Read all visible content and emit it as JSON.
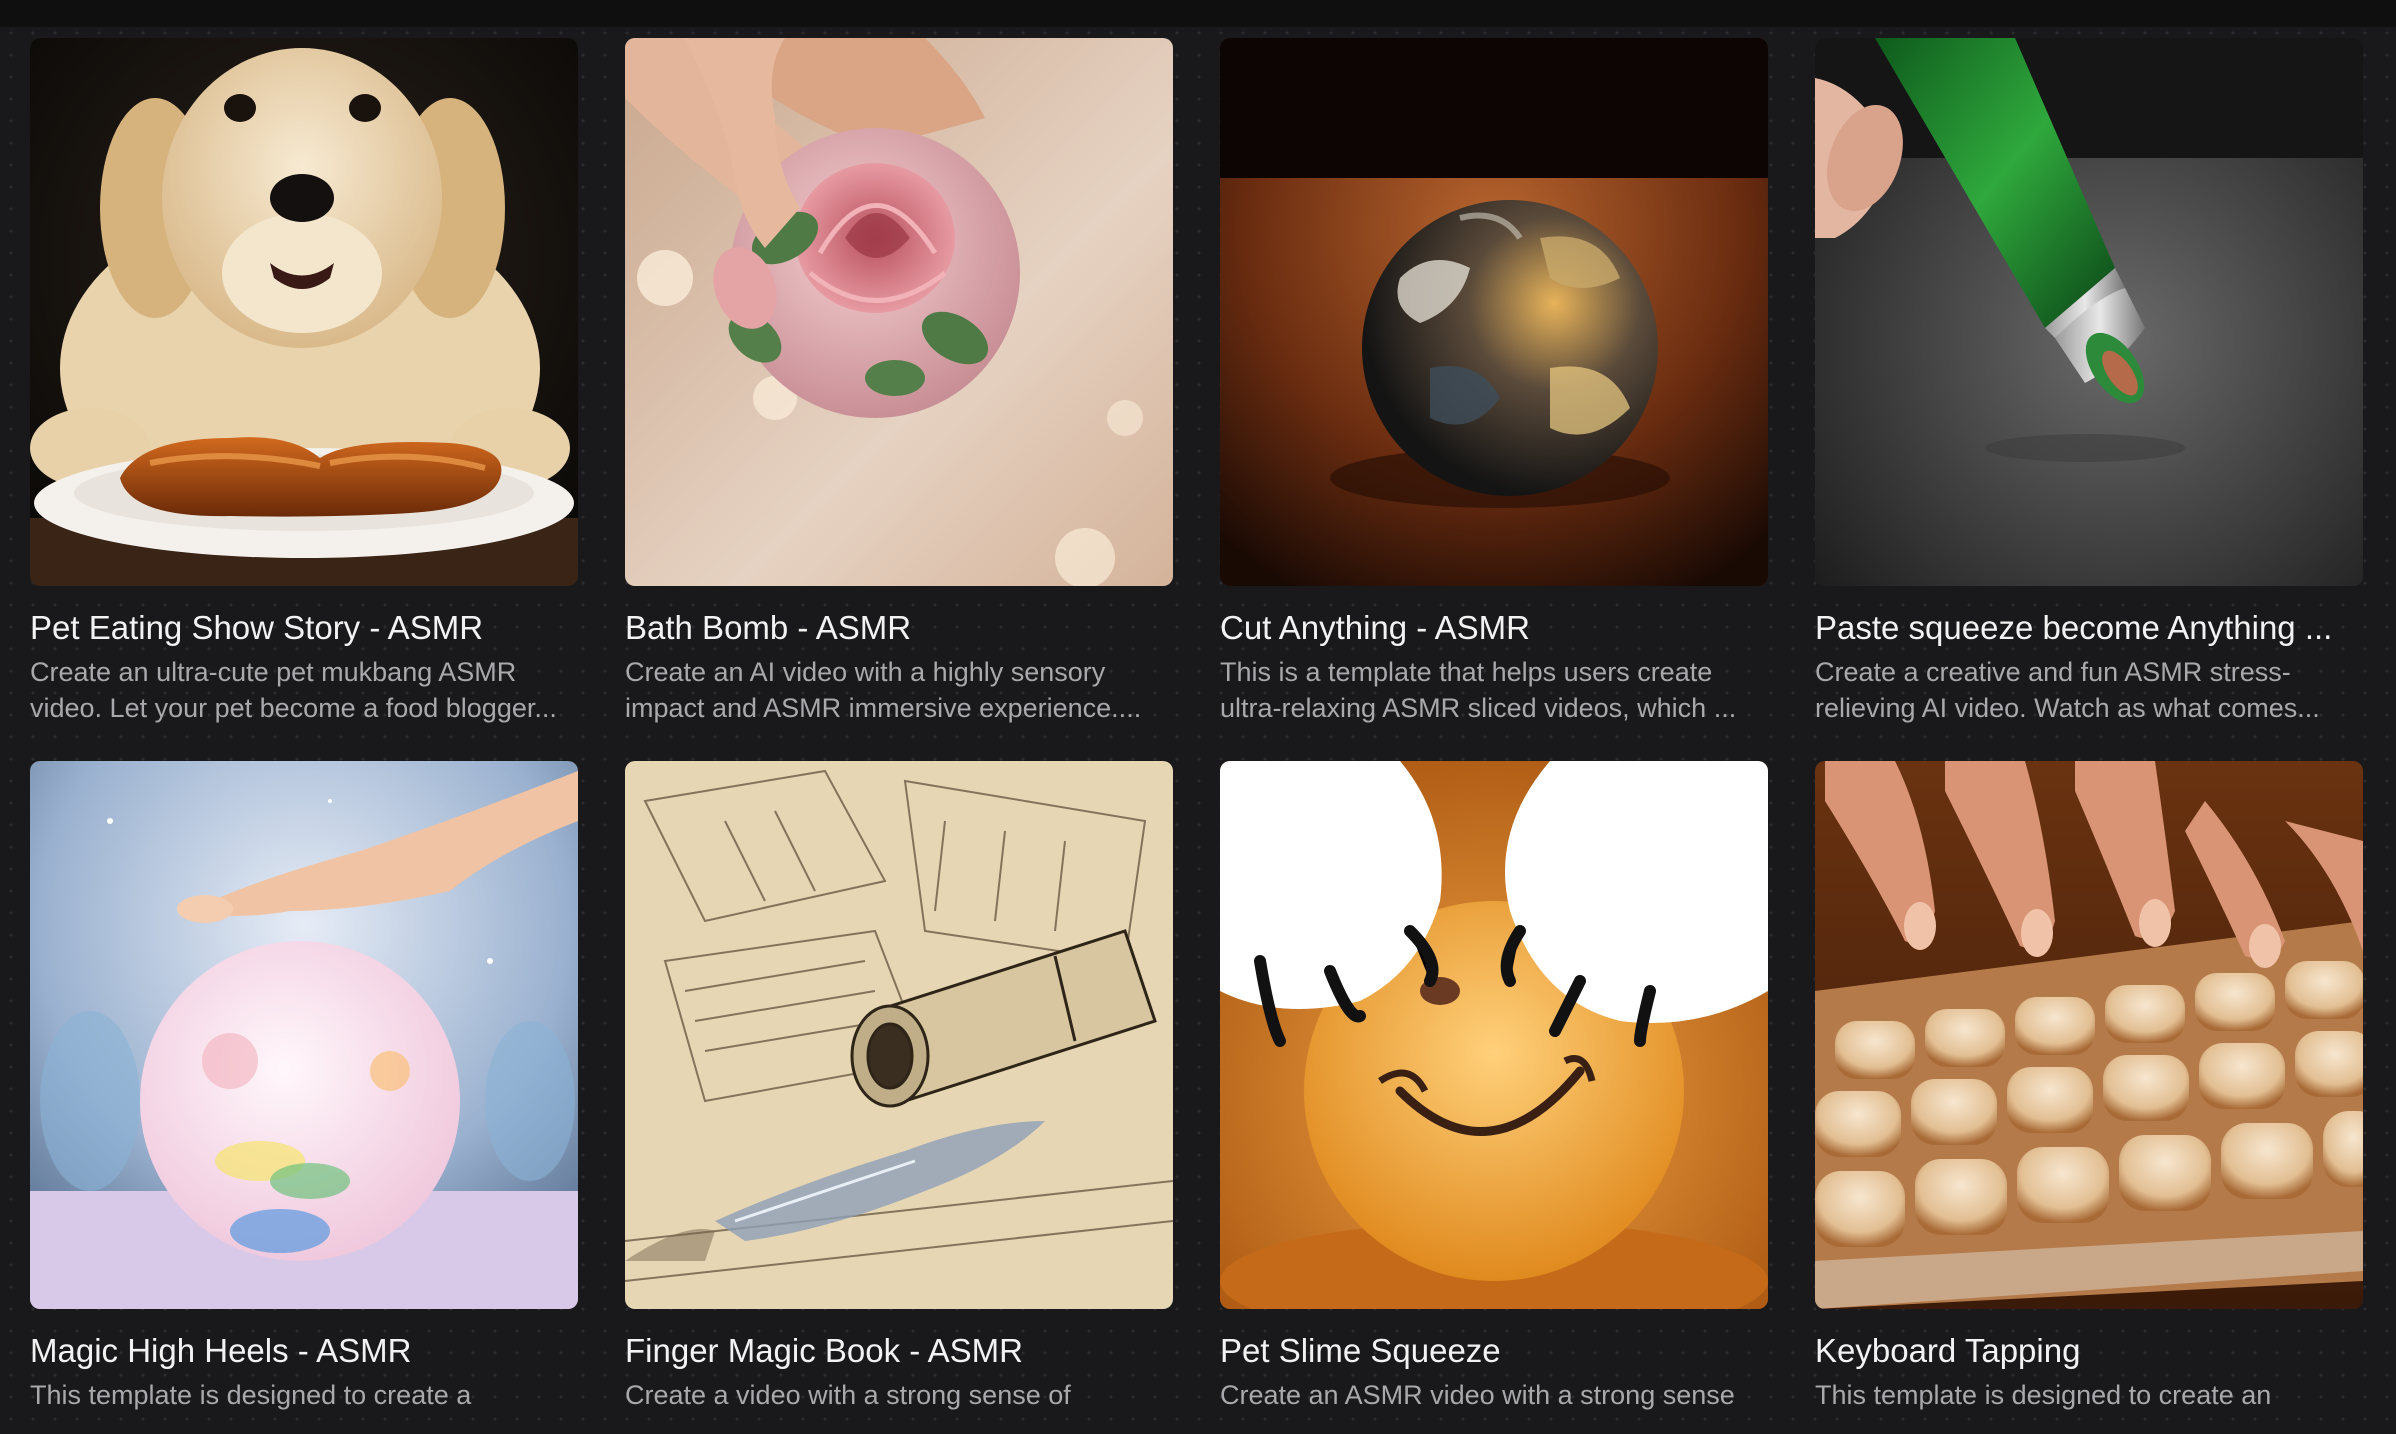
{
  "templates": [
    {
      "title": "Pet Eating Show Story - ASMR",
      "description": "Create an ultra-cute pet mukbang ASMR video. Let your pet become a food blogger...",
      "image": "golden-retriever-puppy-with-glazed-sausages"
    },
    {
      "title": "Bath Bomb - ASMR",
      "description": "Create an AI video with a highly sensory impact and ASMR immersive experience....",
      "image": "hand-holding-rose-bath-bomb"
    },
    {
      "title": "Cut Anything - ASMR",
      "description": "This is a template that helps users create ultra-relaxing ASMR sliced videos, which ...",
      "image": "earth-globe-sphere-on-wooden-table"
    },
    {
      "title": "Paste squeeze become Anything ...",
      "description": "Create a creative and fun ASMR stress-relieving AI video. Watch as what comes...",
      "image": "green-paste-tube-squeezed"
    },
    {
      "title": "Magic High Heels - ASMR",
      "description": "This template is designed to create a",
      "image": "foot-above-rainbow-cotton-ball"
    },
    {
      "title": "Finger Magic Book - ASMR",
      "description": "Create a video with a strong sense of",
      "image": "pencil-sketch-pipe-and-water"
    },
    {
      "title": "Pet Slime Squeeze",
      "description": "Create an ASMR video with a strong sense",
      "image": "cat-paws-squeezing-smiley-slime"
    },
    {
      "title": "Keyboard Tapping",
      "description": "This template is designed to create an",
      "image": "fingers-on-marshmallow-keyboard"
    }
  ]
}
